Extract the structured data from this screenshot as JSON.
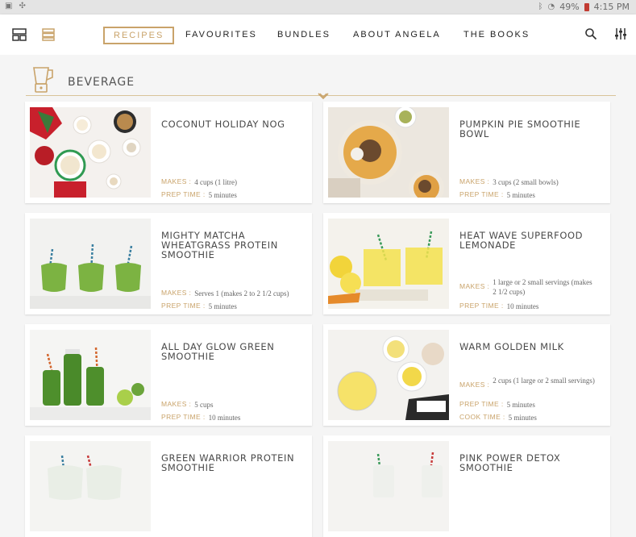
{
  "status": {
    "battery": "49%",
    "time": "4:15 PM"
  },
  "nav": {
    "items": [
      "RECIPES",
      "FAVOURITES",
      "BUNDLES",
      "ABOUT ANGELA",
      "THE BOOKS"
    ]
  },
  "section": {
    "title": "BEVERAGE"
  },
  "labels": {
    "makes": "MAKES :",
    "prep": "PREP TIME :",
    "cook": "COOK TIME :"
  },
  "recipes": [
    {
      "title": "COCONUT HOLIDAY NOG",
      "makes": "4 cups (1 litre)",
      "prep": "5 minutes",
      "cook": ""
    },
    {
      "title": "PUMPKIN PIE SMOOTHIE BOWL",
      "makes": "3 cups (2 small bowls)",
      "prep": "5 minutes",
      "cook": ""
    },
    {
      "title": "MIGHTY MATCHA WHEATGRASS PROTEIN SMOOTHIE",
      "makes": "Serves 1 (makes 2 to 2 1/2 cups)",
      "prep": "5 minutes",
      "cook": ""
    },
    {
      "title": "HEAT WAVE SUPERFOOD LEMONADE",
      "makes": "1 large or 2 small servings (makes 2 1/2 cups)",
      "prep": "10 minutes",
      "cook": ""
    },
    {
      "title": "ALL DAY GLOW GREEN SMOOTHIE",
      "makes": "5 cups",
      "prep": "10 minutes",
      "cook": ""
    },
    {
      "title": "WARM GOLDEN MILK",
      "makes": "2 cups (1 large or 2 small servings)",
      "prep": "5 minutes",
      "cook": "5 minutes"
    },
    {
      "title": "GREEN WARRIOR PROTEIN SMOOTHIE",
      "makes": "",
      "prep": "",
      "cook": ""
    },
    {
      "title": "PINK POWER DETOX SMOOTHIE",
      "makes": "",
      "prep": "",
      "cook": ""
    }
  ],
  "colors": {
    "accent": "#c9a36a",
    "text": "#4a4a4a"
  }
}
